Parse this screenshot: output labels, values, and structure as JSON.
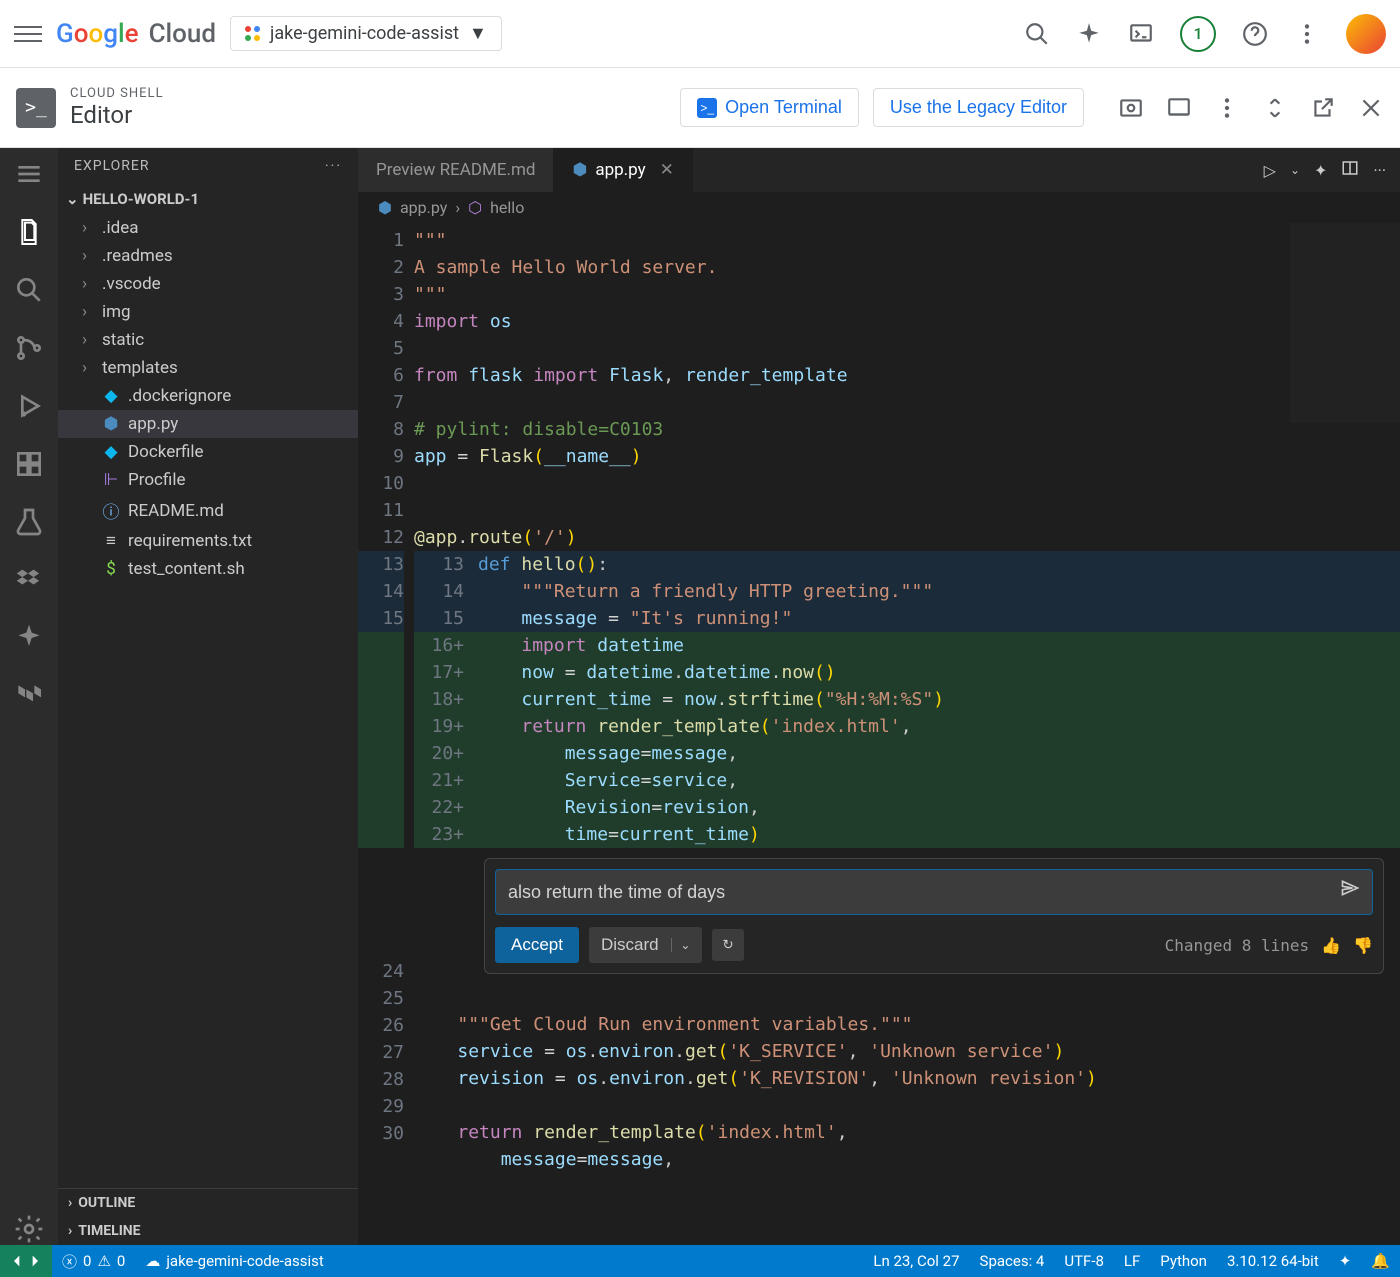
{
  "gcp": {
    "logo_text": "Cloud",
    "project": "jake-gemini-code-assist",
    "badge": "1"
  },
  "shell": {
    "small": "CLOUD SHELL",
    "big": "Editor",
    "open_terminal": "Open Terminal",
    "legacy": "Use the Legacy Editor"
  },
  "sidebar": {
    "title": "EXPLORER",
    "folder": "HELLO-WORLD-1",
    "items": [
      {
        "name": ".idea",
        "type": "folder"
      },
      {
        "name": ".readmes",
        "type": "folder"
      },
      {
        "name": ".vscode",
        "type": "folder"
      },
      {
        "name": "img",
        "type": "folder"
      },
      {
        "name": "static",
        "type": "folder"
      },
      {
        "name": "templates",
        "type": "folder"
      },
      {
        "name": ".dockerignore",
        "type": "file",
        "icon": "docker"
      },
      {
        "name": "app.py",
        "type": "file",
        "icon": "python",
        "selected": true
      },
      {
        "name": "Dockerfile",
        "type": "file",
        "icon": "docker"
      },
      {
        "name": "Procfile",
        "type": "file",
        "icon": "heroku"
      },
      {
        "name": "README.md",
        "type": "file",
        "icon": "info"
      },
      {
        "name": "requirements.txt",
        "type": "file",
        "icon": "text"
      },
      {
        "name": "test_content.sh",
        "type": "file",
        "icon": "shell"
      }
    ],
    "outline": "OUTLINE",
    "timeline": "TIMELINE"
  },
  "tabs": [
    {
      "label": "Preview README.md",
      "active": false
    },
    {
      "label": "app.py",
      "active": true,
      "icon": "python"
    }
  ],
  "breadcrumb": {
    "file": "app.py",
    "symbol": "hello"
  },
  "code": {
    "lines": [
      {
        "n": 1,
        "html": "<span class='s-str'>\"\"\"</span>"
      },
      {
        "n": 2,
        "html": "<span class='s-str'>A sample Hello World server.</span>"
      },
      {
        "n": 3,
        "html": "<span class='s-str'>\"\"\"</span>"
      },
      {
        "n": 4,
        "html": "<span class='s-kw2'>import</span> <span class='s-var'>os</span>"
      },
      {
        "n": 5,
        "html": ""
      },
      {
        "n": 6,
        "html": "<span class='s-kw2'>from</span> <span class='s-var'>flask</span> <span class='s-kw2'>import</span> <span class='s-var'>Flask</span>, <span class='s-var'>render_template</span>"
      },
      {
        "n": 7,
        "html": ""
      },
      {
        "n": 8,
        "html": "<span class='s-cm'># pylint: disable=C0103</span>"
      },
      {
        "n": 9,
        "html": "<span class='s-var'>app</span> <span class='s-op'>=</span> <span class='s-fn'>Flask</span><span class='s-par'>(</span><span class='s-var'>__name__</span><span class='s-par'>)</span>"
      },
      {
        "n": 10,
        "html": ""
      },
      {
        "n": 11,
        "html": ""
      },
      {
        "n": 12,
        "html": "<span class='s-fn'>@app</span>.<span class='s-fn'>route</span><span class='s-par'>(</span><span class='s-str'>'/'</span><span class='s-par'>)</span>"
      }
    ],
    "diff": [
      {
        "n1": "13",
        "n2": "13",
        "added": false,
        "html": "<span class='s-kw'>def</span> <span class='s-fn'>hello</span><span class='s-par'>()</span>:"
      },
      {
        "n1": "14",
        "n2": "14",
        "added": false,
        "html": "    <span class='s-str'>\"\"\"Return a friendly HTTP greeting.\"\"\"</span>"
      },
      {
        "n1": "15",
        "n2": "15",
        "added": false,
        "html": "    <span class='s-var'>message</span> <span class='s-op'>=</span> <span class='s-str'>\"It's running!\"</span>"
      },
      {
        "n1": "",
        "n2": "16+",
        "added": true,
        "html": "    <span class='s-kw2'>import</span> <span class='s-var'>datetime</span>"
      },
      {
        "n1": "",
        "n2": "17+",
        "added": true,
        "html": "    <span class='s-var'>now</span> <span class='s-op'>=</span> <span class='s-var'>datetime</span>.<span class='s-var'>datetime</span>.<span class='s-fn'>now</span><span class='s-par'>()</span>"
      },
      {
        "n1": "",
        "n2": "18+",
        "added": true,
        "html": "    <span class='s-var'>current_time</span> <span class='s-op'>=</span> <span class='s-var'>now</span>.<span class='s-fn'>strftime</span><span class='s-par'>(</span><span class='s-str'>\"%H:%M:%S\"</span><span class='s-par'>)</span>"
      },
      {
        "n1": "",
        "n2": "19+",
        "added": true,
        "html": "    <span class='s-kw2'>return</span> <span class='s-fn'>render_template</span><span class='s-par'>(</span><span class='s-str'>'index.html'</span>,"
      },
      {
        "n1": "",
        "n2": "20+",
        "added": true,
        "html": "        <span class='s-var'>message</span><span class='s-op'>=</span><span class='s-var'>message</span>,"
      },
      {
        "n1": "",
        "n2": "21+",
        "added": true,
        "html": "        <span class='s-var'>Service</span><span class='s-op'>=</span><span class='s-var'>service</span>,"
      },
      {
        "n1": "",
        "n2": "22+",
        "added": true,
        "html": "        <span class='s-var'>Revision</span><span class='s-op'>=</span><span class='s-var'>revision</span>,"
      },
      {
        "n1": "",
        "n2": "23+",
        "added": true,
        "html": "        <span class='s-var'>time</span><span class='s-op'>=</span><span class='s-var'>current_time</span><span class='s-par'>)</span>"
      }
    ],
    "after": [
      {
        "n": 24,
        "html": ""
      },
      {
        "n": 25,
        "html": "    <span class='s-str'>\"\"\"Get Cloud Run environment variables.\"\"\"</span>"
      },
      {
        "n": 26,
        "html": "    <span class='s-var'>service</span> <span class='s-op'>=</span> <span class='s-var'>os</span>.<span class='s-var'>environ</span>.<span class='s-fn'>get</span><span class='s-par'>(</span><span class='s-str'>'K_SERVICE'</span>, <span class='s-str'>'Unknown service'</span><span class='s-par'>)</span>"
      },
      {
        "n": 27,
        "html": "    <span class='s-var'>revision</span> <span class='s-op'>=</span> <span class='s-var'>os</span>.<span class='s-var'>environ</span>.<span class='s-fn'>get</span><span class='s-par'>(</span><span class='s-str'>'K_REVISION'</span>, <span class='s-str'>'Unknown revision'</span><span class='s-par'>)</span>"
      },
      {
        "n": 28,
        "html": ""
      },
      {
        "n": 29,
        "html": "    <span class='s-kw2'>return</span> <span class='s-fn'>render_template</span><span class='s-par'>(</span><span class='s-str'>'index.html'</span>,"
      },
      {
        "n": 30,
        "html": "        <span class='s-var'>message</span><span class='s-op'>=</span><span class='s-var'>message</span>,"
      }
    ]
  },
  "ai": {
    "prompt": "also return the time of days",
    "accept": "Accept",
    "discard": "Discard",
    "changed": "Changed 8 lines"
  },
  "status": {
    "errors": "0",
    "warnings": "0",
    "project": "jake-gemini-code-assist",
    "pos": "Ln 23, Col 27",
    "spaces": "Spaces: 4",
    "encoding": "UTF-8",
    "eol": "LF",
    "lang": "Python",
    "runtime": "3.10.12 64-bit"
  }
}
